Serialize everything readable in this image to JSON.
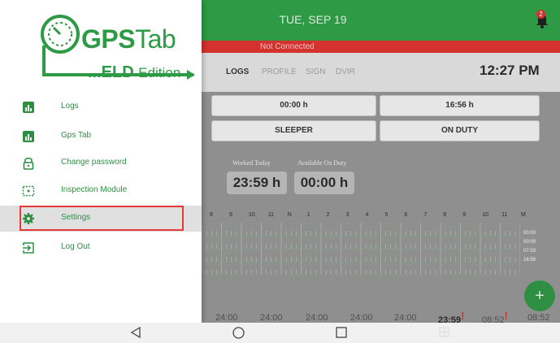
{
  "header": {
    "date": "TUE, SEP 19",
    "notification_count": "2",
    "status": "Not Connected",
    "time": "12:27 PM"
  },
  "tabs": [
    {
      "label": "LOGS",
      "active": true
    },
    {
      "label": "PROFILE",
      "active": false
    },
    {
      "label": "SIGN",
      "active": false
    },
    {
      "label": "DVIR",
      "active": false
    }
  ],
  "status_boxes": {
    "left_time": "00:00 h",
    "right_time": "16:56 h",
    "left_status": "SLEEPER",
    "right_status": "ON DUTY"
  },
  "summary": {
    "worked_label": "Worked Today",
    "worked_value": "23:59 h",
    "available_label": "Available On Duty",
    "available_value": "00:00 h"
  },
  "chart": {
    "hours": [
      "8",
      "9",
      "10",
      "11",
      "N",
      "1",
      "2",
      "3",
      "4",
      "5",
      "6",
      "7",
      "8",
      "9",
      "10",
      "11",
      "M"
    ],
    "row_totals": [
      "00:00",
      "00:00",
      "07:03",
      "16:56"
    ]
  },
  "totals": [
    {
      "value": "24:00",
      "flag": false
    },
    {
      "value": "24:00",
      "flag": false
    },
    {
      "value": "24:00",
      "flag": false
    },
    {
      "value": "24:00",
      "flag": false
    },
    {
      "value": "24:00",
      "flag": false
    },
    {
      "value": "23:59",
      "flag": true
    },
    {
      "value": "08:52",
      "flag": true
    },
    {
      "value": "08:52",
      "flag": false
    }
  ],
  "fab_symbol": "+",
  "drawer": {
    "logo": {
      "brand": "GPS",
      "brand_thin": "Tab",
      "sub": "...ELD",
      "sub_thin": "Edition"
    },
    "items": [
      {
        "label": "Logs",
        "icon": "bar-chart-icon"
      },
      {
        "label": "Gps Tab",
        "icon": "bar-chart-icon"
      },
      {
        "label": "Change password",
        "icon": "lock-icon"
      },
      {
        "label": "Inspection Module",
        "icon": "inspection-icon"
      },
      {
        "label": "Settings",
        "icon": "gear-icon",
        "selected": true
      },
      {
        "label": "Log Out",
        "icon": "logout-icon"
      }
    ]
  },
  "colors": {
    "primary": "#2e9a45",
    "danger": "#d3322f",
    "highlight_border": "#e53935"
  }
}
